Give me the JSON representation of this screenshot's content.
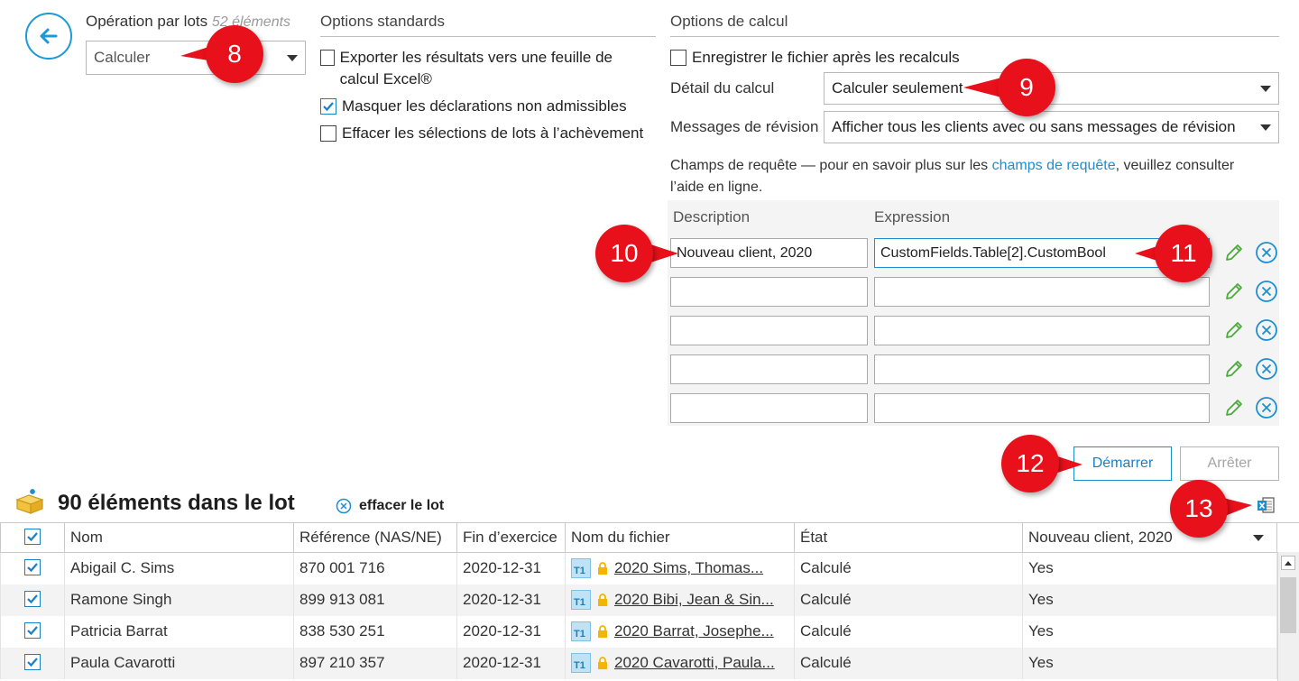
{
  "batch": {
    "label": "Opération par lots",
    "count_text": "52 éléments",
    "operation_selected": "Calculer"
  },
  "standard_options": {
    "title": "Options standards",
    "items": [
      {
        "label": "Exporter les résultats vers une feuille de calcul Excel®",
        "checked": false
      },
      {
        "label": "Masquer les déclarations non admissibles",
        "checked": true
      },
      {
        "label": "Effacer les sélections de lots à l’achèvement",
        "checked": false
      }
    ]
  },
  "calc_options": {
    "title": "Options de calcul",
    "save_after_label": "Enregistrer le fichier après les recalculs",
    "detail_label": "Détail du calcul",
    "detail_selected": "Calculer seulement",
    "messages_label": "Messages de révision",
    "messages_selected": "Afficher tous les clients avec ou sans messages de révision",
    "help_prefix": "Champs de requête — pour en savoir plus sur les ",
    "help_link": "champs de requête",
    "help_suffix": ", veuillez consulter l’aide en ligne.",
    "col_description": "Description",
    "col_expression": "Expression",
    "rows": [
      {
        "description": "Nouveau client, 2020",
        "expression": "CustomFields.Table[2].CustomBool"
      },
      {
        "description": "",
        "expression": ""
      },
      {
        "description": "",
        "expression": ""
      },
      {
        "description": "",
        "expression": ""
      },
      {
        "description": "",
        "expression": ""
      }
    ]
  },
  "buttons": {
    "start": "Démarrer",
    "stop": "Arrêter"
  },
  "lot": {
    "title": "90 éléments dans le lot",
    "clear_label": "effacer le lot"
  },
  "callouts": [
    "8",
    "9",
    "10",
    "11",
    "12",
    "13"
  ],
  "table": {
    "headers": [
      "Nom",
      "Référence (NAS/NE)",
      "Fin d’exercice",
      "Nom du fichier",
      "État",
      "Nouveau client, 2020"
    ],
    "rows": [
      {
        "name": "Abigail C. Sims",
        "ref": "870 001 716",
        "year_end": "2020-12-31",
        "file": "2020 Sims, Thomas...",
        "status": "Calculé",
        "new_client": "Yes"
      },
      {
        "name": "Ramone Singh",
        "ref": "899 913 081",
        "year_end": "2020-12-31",
        "file": "2020 Bibi, Jean & Sin...",
        "status": "Calculé",
        "new_client": "Yes"
      },
      {
        "name": "Patricia Barrat",
        "ref": "838 530 251",
        "year_end": "2020-12-31",
        "file": "2020 Barrat, Josephe...",
        "status": "Calculé",
        "new_client": "Yes"
      },
      {
        "name": "Paula Cavarotti",
        "ref": "897 210 357",
        "year_end": "2020-12-31",
        "file": "2020 Cavarotti, Paula...",
        "status": "Calculé",
        "new_client": "Yes"
      }
    ]
  },
  "colors": {
    "accent": "#1b8fd0",
    "callout": "#e8101a"
  },
  "icons": [
    "back-arrow-icon",
    "pencil-icon",
    "remove-circle-icon",
    "box-icon",
    "export-excel-icon",
    "t1-file-icon",
    "lock-icon",
    "check-icon"
  ]
}
